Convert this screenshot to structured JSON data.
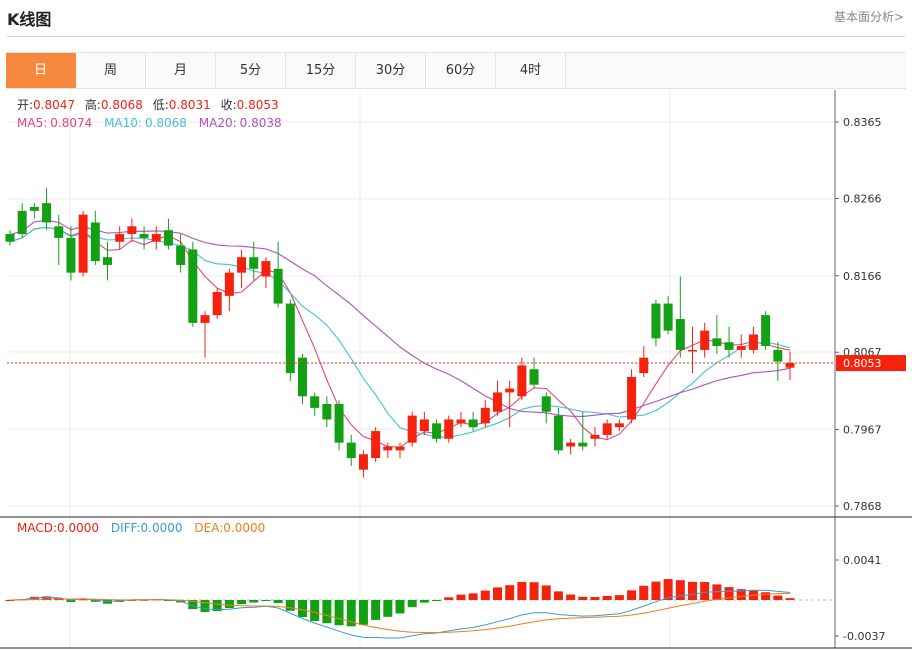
{
  "header": {
    "title": "K线图",
    "more_link": "基本面分析>"
  },
  "tabs": [
    {
      "label": "日",
      "active": true
    },
    {
      "label": "周",
      "active": false
    },
    {
      "label": "月",
      "active": false
    },
    {
      "label": "5分",
      "active": false
    },
    {
      "label": "15分",
      "active": false
    },
    {
      "label": "30分",
      "active": false
    },
    {
      "label": "60分",
      "active": false
    },
    {
      "label": "4时",
      "active": false
    }
  ],
  "colors": {
    "up": "#f5220e",
    "down": "#14a014",
    "ma5": "#e8457c",
    "ma10": "#44c0d8",
    "ma20": "#b04fc0",
    "diff": "#3a9bd6",
    "dea": "#f07d1e",
    "accent": "#f5883c"
  },
  "ohlc_info": {
    "open_label": "开:",
    "open": "0.8047",
    "high_label": "高:",
    "high": "0.8068",
    "low_label": "低:",
    "low": "0.8031",
    "close_label": "收:",
    "close": "0.8053"
  },
  "ma_info": {
    "ma5_label": "MA5:",
    "ma5": "0.8074",
    "ma10_label": "MA10:",
    "ma10": "0.8068",
    "ma20_label": "MA20:",
    "ma20": "0.8038"
  },
  "macd_info": {
    "macd_label": "MACD:",
    "macd": "0.0000",
    "diff_label": "DIFF:",
    "diff": "0.0000",
    "dea_label": "DEA:",
    "dea": "0.0000"
  },
  "chart_data": {
    "type": "candlestick",
    "price_axis": {
      "ticks": [
        "0.8365",
        "0.8266",
        "0.8166",
        "0.8067",
        "0.7967",
        "0.7868"
      ],
      "range": [
        0.7868,
        0.8365
      ]
    },
    "current_price": "0.8053",
    "candles": [
      [
        0.822,
        0.821,
        0.8225,
        0.8205
      ],
      [
        0.825,
        0.822,
        0.826,
        0.8215
      ],
      [
        0.8255,
        0.825,
        0.826,
        0.824
      ],
      [
        0.826,
        0.8235,
        0.828,
        0.8225
      ],
      [
        0.823,
        0.8215,
        0.8245,
        0.818
      ],
      [
        0.8215,
        0.817,
        0.823,
        0.816
      ],
      [
        0.817,
        0.8245,
        0.825,
        0.8165
      ],
      [
        0.8235,
        0.8185,
        0.825,
        0.818
      ],
      [
        0.819,
        0.818,
        0.821,
        0.816
      ],
      [
        0.821,
        0.822,
        0.823,
        0.82
      ],
      [
        0.822,
        0.823,
        0.824,
        0.821
      ],
      [
        0.822,
        0.8215,
        0.823,
        0.82
      ],
      [
        0.821,
        0.822,
        0.823,
        0.82
      ],
      [
        0.8225,
        0.8205,
        0.824,
        0.82
      ],
      [
        0.8205,
        0.818,
        0.822,
        0.817
      ],
      [
        0.82,
        0.8105,
        0.821,
        0.81
      ],
      [
        0.8105,
        0.8115,
        0.812,
        0.806
      ],
      [
        0.8115,
        0.8145,
        0.815,
        0.811
      ],
      [
        0.814,
        0.817,
        0.8175,
        0.812
      ],
      [
        0.817,
        0.819,
        0.82,
        0.815
      ],
      [
        0.819,
        0.8175,
        0.821,
        0.816
      ],
      [
        0.8165,
        0.8185,
        0.819,
        0.815
      ],
      [
        0.8175,
        0.813,
        0.821,
        0.8125
      ],
      [
        0.813,
        0.804,
        0.8135,
        0.803
      ],
      [
        0.806,
        0.801,
        0.8065,
        0.8
      ],
      [
        0.801,
        0.7995,
        0.8015,
        0.7985
      ],
      [
        0.8,
        0.798,
        0.801,
        0.797
      ],
      [
        0.8,
        0.795,
        0.8005,
        0.794
      ],
      [
        0.795,
        0.793,
        0.796,
        0.792
      ],
      [
        0.7915,
        0.7935,
        0.794,
        0.7905
      ],
      [
        0.793,
        0.7965,
        0.797,
        0.7925
      ],
      [
        0.794,
        0.7945,
        0.795,
        0.793
      ],
      [
        0.794,
        0.7945,
        0.795,
        0.793
      ],
      [
        0.795,
        0.7985,
        0.799,
        0.7945
      ],
      [
        0.7965,
        0.798,
        0.799,
        0.796
      ],
      [
        0.7975,
        0.7955,
        0.798,
        0.795
      ],
      [
        0.7955,
        0.798,
        0.7985,
        0.795
      ],
      [
        0.7975,
        0.798,
        0.799,
        0.797
      ],
      [
        0.798,
        0.797,
        0.799,
        0.7965
      ],
      [
        0.7975,
        0.7995,
        0.8005,
        0.797
      ],
      [
        0.799,
        0.8015,
        0.803,
        0.7985
      ],
      [
        0.8015,
        0.802,
        0.803,
        0.797
      ],
      [
        0.801,
        0.805,
        0.806,
        0.8005
      ],
      [
        0.8045,
        0.8025,
        0.806,
        0.802
      ],
      [
        0.801,
        0.799,
        0.8015,
        0.7975
      ],
      [
        0.7985,
        0.794,
        0.7995,
        0.7935
      ],
      [
        0.7945,
        0.795,
        0.7955,
        0.7935
      ],
      [
        0.795,
        0.7945,
        0.799,
        0.794
      ],
      [
        0.7955,
        0.796,
        0.797,
        0.7945
      ],
      [
        0.796,
        0.7975,
        0.798,
        0.7955
      ],
      [
        0.797,
        0.7975,
        0.798,
        0.7965
      ],
      [
        0.798,
        0.8035,
        0.8045,
        0.7975
      ],
      [
        0.804,
        0.806,
        0.8075,
        0.8035
      ],
      [
        0.813,
        0.8085,
        0.8135,
        0.8075
      ],
      [
        0.813,
        0.8095,
        0.814,
        0.809
      ],
      [
        0.811,
        0.807,
        0.8165,
        0.806
      ],
      [
        0.807,
        0.807,
        0.81,
        0.804
      ],
      [
        0.807,
        0.8095,
        0.8105,
        0.806
      ],
      [
        0.8085,
        0.8075,
        0.8115,
        0.8065
      ],
      [
        0.808,
        0.807,
        0.81,
        0.806
      ],
      [
        0.807,
        0.8075,
        0.809,
        0.806
      ],
      [
        0.807,
        0.809,
        0.81,
        0.8065
      ],
      [
        0.8115,
        0.8075,
        0.812,
        0.807
      ],
      [
        0.807,
        0.8055,
        0.808,
        0.803
      ],
      [
        0.8047,
        0.8053,
        0.8068,
        0.8031
      ]
    ],
    "macd_axis": {
      "ticks": [
        "0.0041",
        "-0.0037"
      ]
    }
  }
}
